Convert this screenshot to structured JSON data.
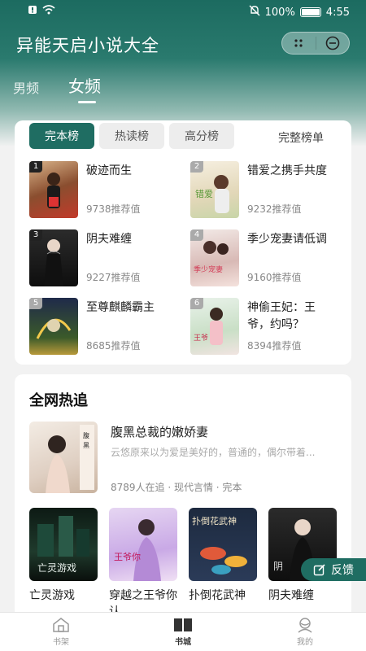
{
  "status_bar": {
    "battery": "100%",
    "time": "4:55"
  },
  "header": {
    "title": "异能天启小说大全"
  },
  "gender_tabs": [
    {
      "label": "男频",
      "active": false
    },
    {
      "label": "女频",
      "active": true
    }
  ],
  "ranking": {
    "tabs": [
      {
        "label": "完本榜",
        "active": true
      },
      {
        "label": "热读榜",
        "active": false
      },
      {
        "label": "高分榜",
        "active": false
      }
    ],
    "full_label": "完整榜单",
    "items": [
      {
        "rank": "1",
        "title": "破迹而生",
        "rec": "9738推荐值"
      },
      {
        "rank": "2",
        "title": "错爱之携手共度",
        "rec": "9232推荐值"
      },
      {
        "rank": "3",
        "title": "阴夫难缠",
        "rec": "9227推荐值"
      },
      {
        "rank": "4",
        "title": "季少宠妻请低调",
        "rec": "9160推荐值"
      },
      {
        "rank": "5",
        "title": "至尊麒麟霸主",
        "rec": "8685推荐值"
      },
      {
        "rank": "6",
        "title": "神偷王妃：王爷，约吗？",
        "rec": "8394推荐值"
      }
    ]
  },
  "hot": {
    "title": "全网热追",
    "featured": {
      "name": "腹黑总裁的嫩娇妻",
      "desc": "云悠原来以为爱是美好的，普通的，偶尔带着...",
      "meta": "8789人在追 · 现代言情 · 完本"
    },
    "grid": [
      {
        "name": "亡灵游戏"
      },
      {
        "name": "穿越之王爷你认"
      },
      {
        "name": "扑倒花武神"
      },
      {
        "name": "阴夫难缠"
      }
    ]
  },
  "feedback": {
    "label": "反馈"
  },
  "bottom_nav": [
    {
      "label": "书架",
      "active": false
    },
    {
      "label": "书城",
      "active": true
    },
    {
      "label": "我的",
      "active": false
    }
  ]
}
